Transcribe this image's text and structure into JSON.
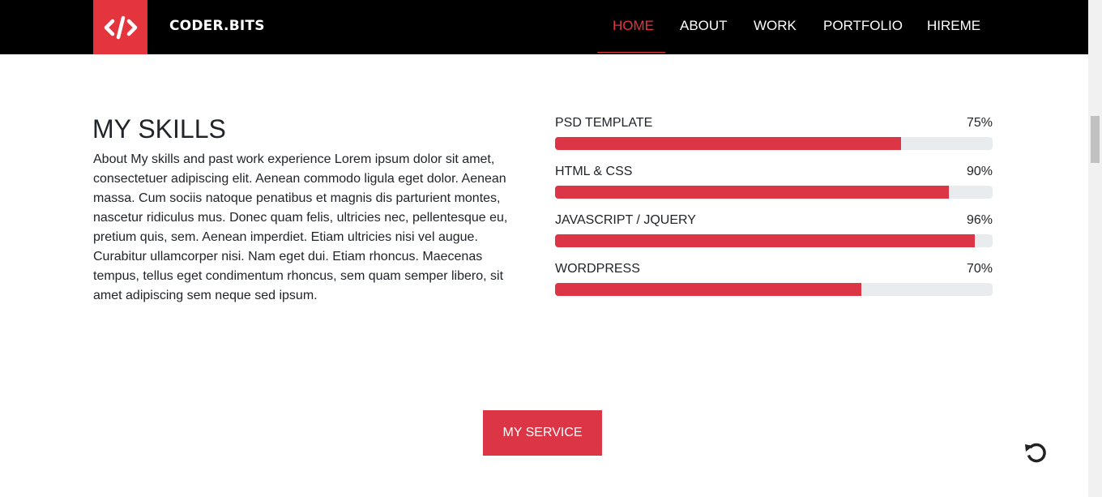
{
  "header": {
    "brand": "CODER.BITS",
    "logo_icon": "code-icon",
    "nav": [
      {
        "label": "HOME",
        "active": true
      },
      {
        "label": "ABOUT",
        "active": false
      },
      {
        "label": "WORK",
        "active": false
      },
      {
        "label": "PORTFOLIO",
        "active": false
      },
      {
        "label": "HIREME",
        "active": false
      }
    ]
  },
  "skills": {
    "title": "MY SKILLS",
    "description": "About My skills and past work experience Lorem ipsum dolor sit amet, consectetuer adipiscing elit. Aenean commodo ligula eget dolor. Aenean massa. Cum sociis natoque penatibus et magnis dis parturient montes, nascetur ridiculus mus. Donec quam felis, ultricies nec, pellentesque eu, pretium quis, sem. Aenean imperdiet. Etiam ultricies nisi vel augue. Curabitur ullamcorper nisi. Nam eget dui. Etiam rhoncus. Maecenas tempus, tellus eget condimentum rhoncus, sem quam semper libero, sit amet adipiscing sem neque sed ipsum.",
    "items": [
      {
        "name": "PSD TEMPLATE",
        "percent_label": "75%",
        "value": 0.79
      },
      {
        "name": "HTML & CSS",
        "percent_label": "90%",
        "value": 0.9
      },
      {
        "name": "JAVASCRIPT / JQUERY",
        "percent_label": "96%",
        "value": 0.96
      },
      {
        "name": "WORDPRESS",
        "percent_label": "70%",
        "value": 0.7
      }
    ]
  },
  "service_button": "MY SERVICE",
  "floating_icon": "reload-icon",
  "colors": {
    "accent": "#e4353f",
    "progress_fill": "#dc3545",
    "progress_track": "#e9ecef",
    "nav_bg": "#000000"
  }
}
